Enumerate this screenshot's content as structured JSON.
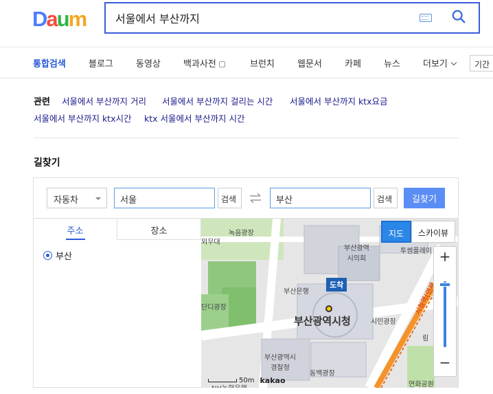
{
  "header": {
    "logo_letters": [
      "D",
      "a",
      "u",
      "m"
    ],
    "logo_colors": [
      "#4d7cfe",
      "#f24d3d",
      "#2fb54a",
      "#f5a623"
    ],
    "search_value": "서울에서 부산까지"
  },
  "tabs": {
    "items": [
      "통합검색",
      "블로그",
      "동영상",
      "백과사전",
      "브런치",
      "웹문서",
      "카페",
      "뉴스",
      "더보기"
    ],
    "period": "기간"
  },
  "related": {
    "title": "관련",
    "links": [
      "서울에서 부산까지 거리",
      "서울에서 부산까지 걸리는 시간",
      "서울에서 부산까지 ktx요금",
      "서울에서 부산까지 ktx시간",
      "ktx 서울에서 부산까지 시간"
    ]
  },
  "route": {
    "section_title": "길찾기",
    "mode": "자동차",
    "origin": "서울",
    "destination": "부산",
    "search_label": "검색",
    "go_label": "길찾기",
    "result_tabs": [
      "주소",
      "장소"
    ],
    "selected_result": "부산"
  },
  "map": {
    "toggle_map": "지도",
    "toggle_sky": "스카이뷰",
    "zoom_in": "+",
    "zoom_out": "−",
    "dest_flag": "도착",
    "scale": "50m",
    "brand": "kakao",
    "labels": {
      "plaza": "녹음광장",
      "guard": "외무대",
      "cityhall_office": "부산광역\n시의회",
      "tower": "투썸플레이",
      "bank": "부산은행",
      "cityhall": "부산광역시청",
      "citizen": "시민광장",
      "dandi": "단디광장",
      "police": "부산광역시\n경찰청",
      "dongbaek": "동백광장",
      "station": "시청역(연제",
      "park": "연화공원",
      "rim": "림",
      "bottom": "NH농협은행"
    }
  }
}
